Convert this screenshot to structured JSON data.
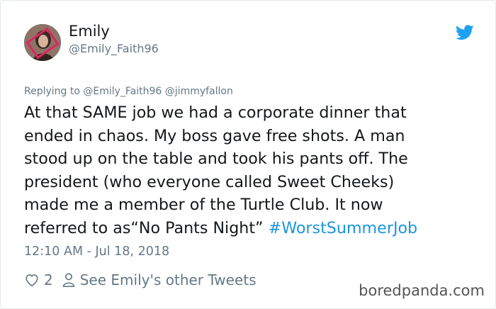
{
  "user": {
    "name": "Emily",
    "handle": "@Emily_Faith96"
  },
  "reply_context": "Replying to @Emily_Faith96 @jimmyfallon",
  "tweet": {
    "text": "At that SAME job we had a corporate dinner that\nended in chaos. My boss gave free shots. A man\nstood up on the table and took his pants off. The\npresident (who everyone called Sweet Cheeks)\nmade me a member of the Turtle Club. It now\nreferred to as“No Pants Night” ",
    "hashtag": "#WorstSummerJob",
    "timestamp": "12:10 AM - Jul 18, 2018",
    "like_count": "2",
    "other_tweets_label": "See Emily's other Tweets"
  },
  "watermark": "boredpanda.com",
  "colors": {
    "twitter_blue": "#1da1f2",
    "link_blue": "#1b95e0",
    "secondary_gray": "#657786",
    "avatar_frame": "#e0245e"
  },
  "icons": {
    "platform": "twitter-bird-icon",
    "like": "heart-icon",
    "profile": "person-icon"
  }
}
